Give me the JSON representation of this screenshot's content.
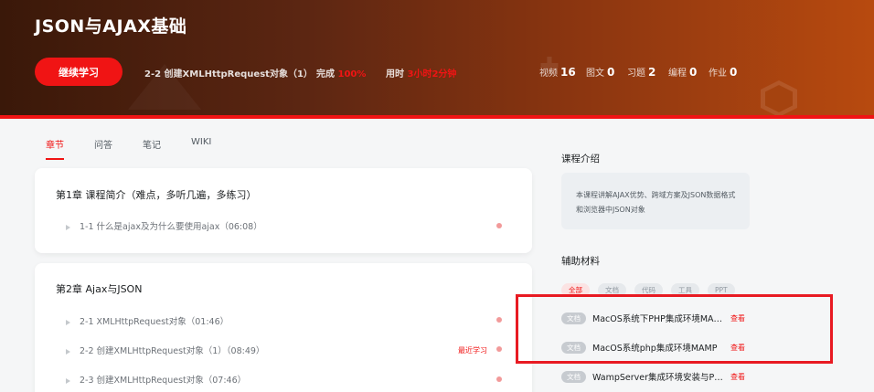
{
  "header": {
    "title": "JSON与AJAX基础",
    "continue_label": "继续学习",
    "current_lesson": "2-2 创建XMLHttpRequest对象（1）",
    "complete_label": "完成",
    "complete_value": "100%",
    "time_label": "用时",
    "time_value": "3小时2分钟",
    "stats": [
      {
        "label": "视频",
        "value": "16"
      },
      {
        "label": "图文",
        "value": "0"
      },
      {
        "label": "习题",
        "value": "2"
      },
      {
        "label": "编程",
        "value": "0"
      },
      {
        "label": "作业",
        "value": "0"
      }
    ]
  },
  "tabs": [
    "章节",
    "问答",
    "笔记",
    "WIKI"
  ],
  "chapters": [
    {
      "title": "第1章 课程简介（难点，多听几遍，多练习）",
      "lessons": [
        {
          "label": "1-1 什么是ajax及为什么要使用ajax（06:08）",
          "recent": ""
        }
      ]
    },
    {
      "title": "第2章 Ajax与JSON",
      "lessons": [
        {
          "label": "2-1 XMLHttpRequest对象（01:46）",
          "recent": ""
        },
        {
          "label": "2-2 创建XMLHttpRequest对象（1）（08:49）",
          "recent": "最近学习"
        },
        {
          "label": "2-3 创建XMLHttpRequest对象（07:46）",
          "recent": ""
        }
      ]
    }
  ],
  "sidebar": {
    "intro_heading": "课程介绍",
    "intro_text": "本课程讲解AJAX优势、跨域方案及JSON数据格式和浏览器中JSON对象",
    "materials_heading": "辅助材料",
    "filters": [
      "全部",
      "文档",
      "代码",
      "工具",
      "PPT"
    ],
    "materials": [
      {
        "tag": "文档",
        "name": "MacOS系统下PHP集成环境MAMP",
        "view": "查看"
      },
      {
        "tag": "文档",
        "name": "MacOS系统php集成环境MAMP",
        "view": "查看"
      },
      {
        "tag": "文档",
        "name": "WampServer集成环境安装与PHP",
        "view": "查看"
      }
    ]
  },
  "colors": {
    "accent": "#f01414",
    "highlight_box": "#e81a22"
  }
}
